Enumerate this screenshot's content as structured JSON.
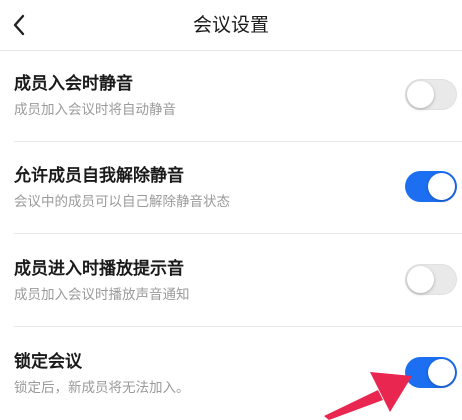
{
  "header": {
    "title": "会议设置",
    "back_icon": "chevron-left-icon"
  },
  "settings": [
    {
      "title": "成员入会时静音",
      "subtitle": "成员加入会议时将自动静音",
      "enabled": false
    },
    {
      "title": "允许成员自我解除静音",
      "subtitle": "会议中的成员可以自己解除静音状态",
      "enabled": true
    },
    {
      "title": "成员进入时播放提示音",
      "subtitle": "成员加入会议时播放声音通知",
      "enabled": false
    },
    {
      "title": "锁定会议",
      "subtitle": "锁定后，新成员将无法加入。",
      "enabled": true
    }
  ],
  "annotation": {
    "icon": "pointer-arrow-icon",
    "color": "#e8264f"
  },
  "colors": {
    "toggle_on": "#1d6ff2",
    "toggle_off": "#e9e9ea"
  }
}
